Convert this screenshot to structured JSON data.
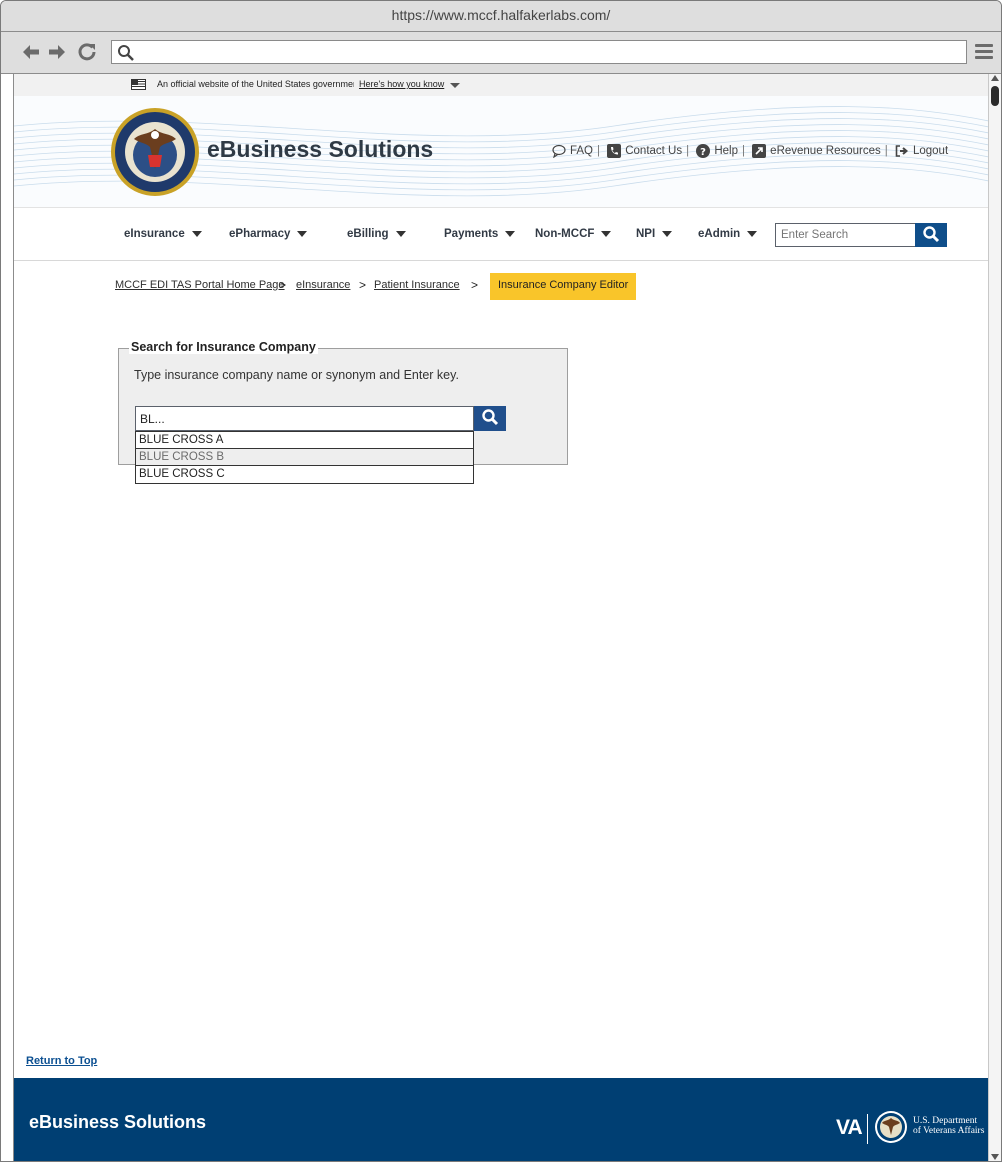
{
  "browser": {
    "url": "https://www.mccf.halfakerlabs.com/"
  },
  "gov_banner": {
    "text": "An official website of the United States government",
    "how_link": "Here's how you know"
  },
  "header": {
    "site_title": "eBusiness Solutions",
    "links": [
      {
        "label": "FAQ",
        "icon": "speech-bubble-icon"
      },
      {
        "label": "Contact Us",
        "icon": "phone-icon"
      },
      {
        "label": "Help",
        "icon": "question-circle-icon"
      },
      {
        "label": "eRevenue Resources",
        "icon": "external-link-icon"
      },
      {
        "label": "Logout",
        "icon": "sign-out-icon"
      }
    ]
  },
  "nav": {
    "items": [
      "eInsurance",
      "ePharmacy",
      "eBilling",
      "Payments",
      "Non-MCCF",
      "NPI",
      "eAdmin"
    ],
    "search_placeholder": "Enter Search"
  },
  "breadcrumb": {
    "items": [
      "MCCF EDI TAS Portal Home Page",
      "eInsurance",
      "Patient Insurance"
    ],
    "current": "Insurance Company Editor"
  },
  "insurance_search": {
    "legend": "Search for Insurance Company",
    "hint": "Type insurance company name or synonym and Enter key.",
    "input_value": "BL...",
    "suggestions": [
      "BLUE CROSS A",
      "BLUE CROSS B",
      "BLUE CROSS C"
    ],
    "highlighted_suggestion": "BLUE CROSS B"
  },
  "return_to_top": "Return to Top",
  "footer": {
    "title": "eBusiness Solutions",
    "logo_va": "VA",
    "logo_dept_line1": "U.S. Department",
    "logo_dept_line2": "of Veterans Affairs"
  },
  "colors": {
    "primary_blue": "#0f4e8a",
    "footer_blue": "#003f73",
    "breadcrumb_highlight": "#f9c52a"
  }
}
